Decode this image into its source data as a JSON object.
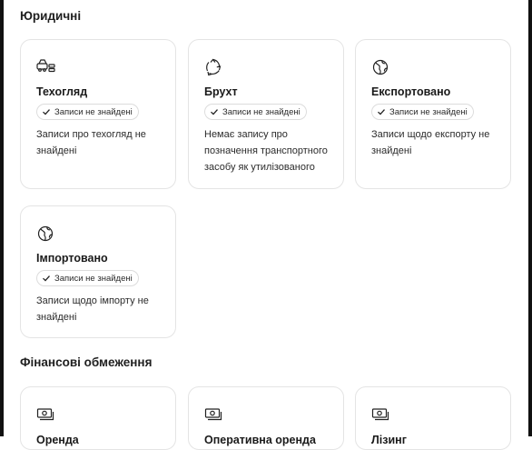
{
  "sections": {
    "legal": {
      "title": "Юридичні",
      "cards": [
        {
          "title": "Техогляд",
          "badge": "Записи не знайдені",
          "description": "Записи про техогляд не знайдені",
          "icon": "car-inspection-icon"
        },
        {
          "title": "Брухт",
          "badge": "Записи не знайдені",
          "description": "Немає запису про позначення транспортного засобу як утилізованого",
          "icon": "recycle-icon"
        },
        {
          "title": "Експортовано",
          "badge": "Записи не знайдені",
          "description": "Записи щодо експорту не знайдені",
          "icon": "globe-icon"
        },
        {
          "title": "Імпортовано",
          "badge": "Записи не знайдені",
          "description": "Записи щодо імпорту не знайдені",
          "icon": "globe-icon"
        }
      ]
    },
    "financial": {
      "title": "Фінансові обмеження",
      "cards": [
        {
          "title": "Оренда",
          "icon": "money-icon"
        },
        {
          "title": "Оперативна оренда",
          "icon": "money-icon"
        },
        {
          "title": "Лізинг",
          "icon": "money-icon"
        }
      ]
    }
  }
}
